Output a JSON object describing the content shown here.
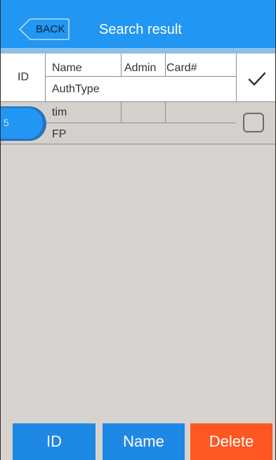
{
  "header": {
    "back_label": "BACK",
    "title": "Search result"
  },
  "table_head": {
    "id_label": "ID",
    "name_label": "Name",
    "admin_label": "Admin",
    "card_label": "Card#",
    "authtype_label": "AuthType"
  },
  "rows": [
    {
      "id": "5",
      "name": "tim",
      "admin": "",
      "card": "",
      "authtype": "FP",
      "checked": false
    }
  ],
  "footer": {
    "id_button": "ID",
    "name_button": "Name",
    "delete_button": "Delete"
  },
  "colors": {
    "primary": "#2196f3",
    "delete": "#ff5722",
    "background": "#d6d3cf"
  },
  "icons": {
    "back": "chevron-left-outline",
    "select_all": "checkmark",
    "row_select": "empty-checkbox"
  }
}
